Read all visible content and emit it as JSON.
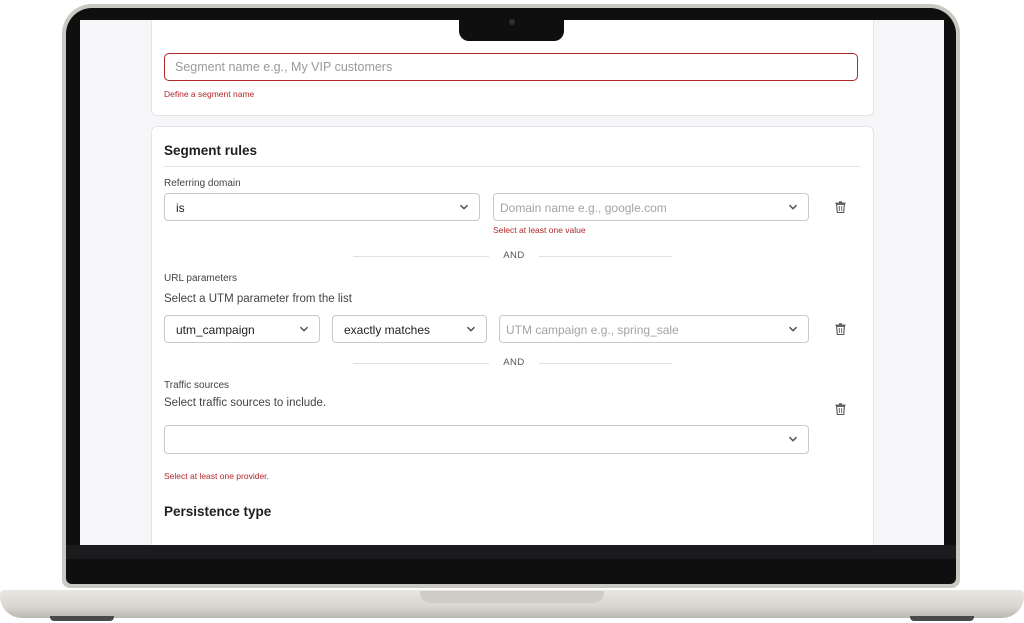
{
  "segment_name": {
    "placeholder": "Segment name e.g., My VIP customers",
    "error": "Define a segment name"
  },
  "segment_rules": {
    "title": "Segment rules",
    "referring_domain": {
      "label": "Referring domain",
      "operator": "is",
      "value_placeholder": "Domain name e.g., google.com",
      "error": "Select at least one value"
    },
    "and_label": "AND",
    "url_parameters": {
      "label": "URL parameters",
      "help": "Select a UTM parameter from the list",
      "parameter": "utm_campaign",
      "operator": "exactly matches",
      "value_placeholder": "UTM campaign e.g., spring_sale"
    },
    "traffic_sources": {
      "label": "Traffic sources",
      "help": "Select traffic sources to include.",
      "error": "Select at least one provider."
    }
  },
  "persistence": {
    "title": "Persistence type"
  },
  "icons": {
    "dropdown": "chevron-down-icon",
    "delete": "trash-icon"
  },
  "colors": {
    "error": "#b3262a",
    "border": "#c9c9cf",
    "background": "#f6f6f8"
  }
}
